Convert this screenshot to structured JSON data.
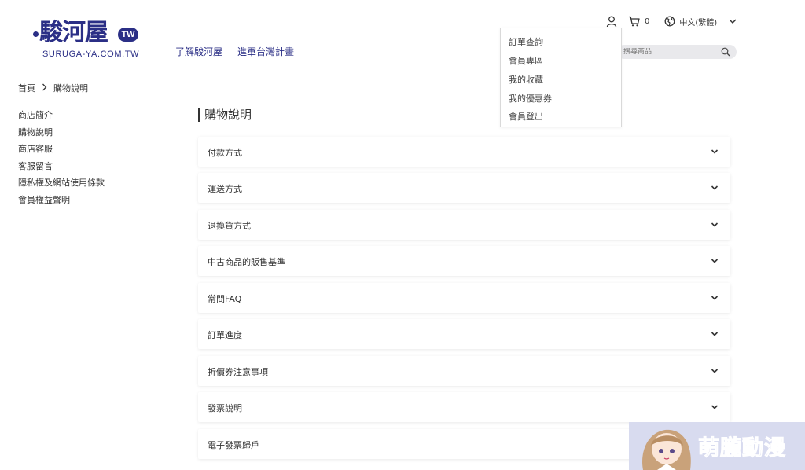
{
  "logo": {
    "mark": "駿河屋",
    "badge": "TW",
    "subtitle": "SURUGA-YA.COM.TW"
  },
  "top_nav": [
    "了解駿河屋",
    "進軍台灣計畫"
  ],
  "utility": {
    "cart_count": "0",
    "language": "中文(繁體)"
  },
  "search": {
    "placeholder": "搜尋商品"
  },
  "account_menu": [
    "訂單查詢",
    "會員專區",
    "我的收藏",
    "我的優惠券",
    "會員登出"
  ],
  "breadcrumb": {
    "home": "首頁",
    "current": "購物說明"
  },
  "sidebar": [
    "商店簡介",
    "購物說明",
    "商店客服",
    "客服留言",
    "隱私權及網站使用條款",
    "會員權益聲明"
  ],
  "main": {
    "title": "購物說明",
    "sections": [
      "付款方式",
      "運送方式",
      "退換貨方式",
      "中古商品的販售基準",
      "常問FAQ",
      "訂單進度",
      "折價券注意事項",
      "發票說明",
      "電子發票歸戶"
    ]
  },
  "watermark": {
    "text": "萌朧動漫"
  }
}
